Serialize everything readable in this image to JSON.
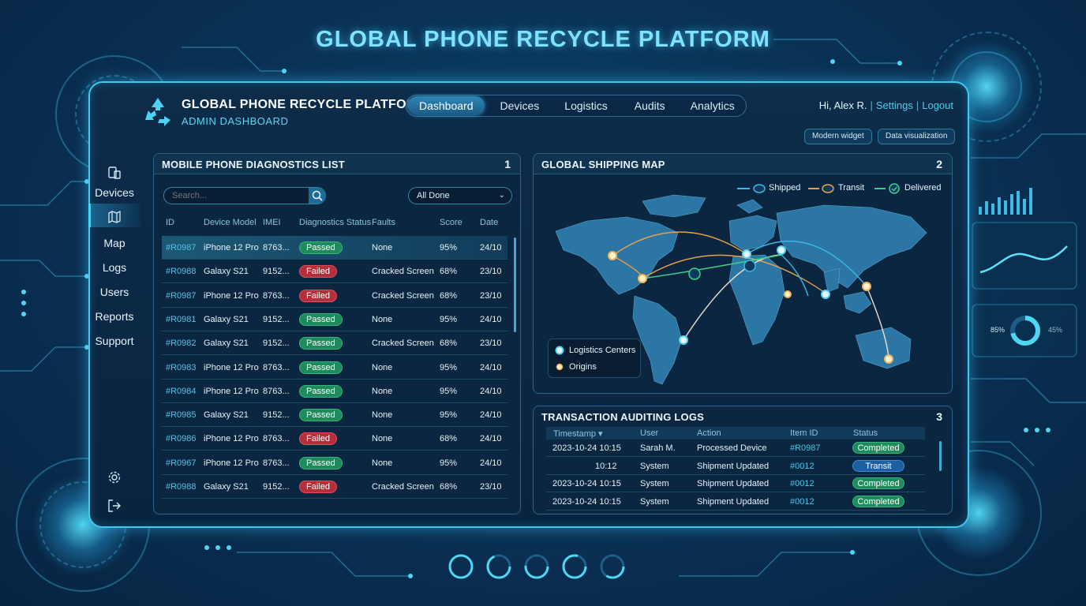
{
  "hero_title": "GLOBAL PHONE RECYCLE PLATFORM",
  "header": {
    "brand": "GLOBAL PHONE RECYCLE PLATFORM",
    "subtitle": "ADMIN DASHBOARD",
    "nav": [
      "Dashboard",
      "Devices",
      "Logistics",
      "Audits",
      "Analytics"
    ],
    "active_nav": "Dashboard",
    "greeting": "Hi, Alex R.",
    "settings": "Settings",
    "logout": "Logout",
    "widget_buttons": [
      "Modern widget",
      "Data visualization"
    ]
  },
  "sidebar": {
    "items": [
      "Devices",
      "Map",
      "Logs",
      "Users",
      "Reports",
      "Support"
    ],
    "active": "Map"
  },
  "diagnostics": {
    "title": "MOBILE PHONE DIAGNOSTICS LIST",
    "number": "1",
    "search_placeholder": "Search...",
    "filter": "All Done",
    "columns": [
      "ID",
      "Device Model",
      "IMEI",
      "Diagnostics Status",
      "Faults",
      "Score",
      "Date"
    ],
    "rows": [
      {
        "id": "#R0987",
        "model": "iPhone 12 Pro",
        "imei": "8763...",
        "status": "Passed",
        "faults": "None",
        "score": "95%",
        "date": "24/10"
      },
      {
        "id": "#R0988",
        "model": "Galaxy S21",
        "imei": "9152...",
        "status": "Failed",
        "faults": "Cracked Screen",
        "score": "68%",
        "date": "23/10"
      },
      {
        "id": "#R0987",
        "model": "iPhone 12 Pro",
        "imei": "8763...",
        "status": "Failed",
        "faults": "Cracked Screen",
        "score": "68%",
        "date": "23/10"
      },
      {
        "id": "#R0981",
        "model": "Galaxy S21",
        "imei": "9152...",
        "status": "Passed",
        "faults": "None",
        "score": "95%",
        "date": "24/10"
      },
      {
        "id": "#R0982",
        "model": "Galaxy S21",
        "imei": "9152...",
        "status": "Passed",
        "faults": "Cracked Screen",
        "score": "68%",
        "date": "23/10"
      },
      {
        "id": "#R0983",
        "model": "iPhone 12 Pro",
        "imei": "8763...",
        "status": "Passed",
        "faults": "None",
        "score": "95%",
        "date": "24/10"
      },
      {
        "id": "#R0984",
        "model": "iPhone 12 Pro",
        "imei": "8763...",
        "status": "Passed",
        "faults": "None",
        "score": "95%",
        "date": "24/10"
      },
      {
        "id": "#R0985",
        "model": "Galaxy S21",
        "imei": "9152...",
        "status": "Passed",
        "faults": "None",
        "score": "95%",
        "date": "24/10"
      },
      {
        "id": "#R0986",
        "model": "iPhone 12 Pro",
        "imei": "8763...",
        "status": "Failed",
        "faults": "None",
        "score": "68%",
        "date": "24/10"
      },
      {
        "id": "#R0967",
        "model": "iPhone 12 Pro",
        "imei": "8763...",
        "status": "Passed",
        "faults": "None",
        "score": "95%",
        "date": "24/10"
      },
      {
        "id": "#R0988",
        "model": "Galaxy S21",
        "imei": "9152...",
        "status": "Failed",
        "faults": "Cracked Screen",
        "score": "68%",
        "date": "23/10"
      }
    ]
  },
  "map": {
    "title": "GLOBAL SHIPPING MAP",
    "number": "2",
    "legend": [
      "Shipped",
      "Transit",
      "Delivered"
    ],
    "legend_colors": [
      "#3ab8e8",
      "#e8a14a",
      "#3fcf8e"
    ],
    "markers_legend": [
      "Logistics Centers",
      "Origins"
    ]
  },
  "logs": {
    "title": "TRANSACTION AUDITING LOGS",
    "number": "3",
    "columns": [
      "Timestamp ▾",
      "User",
      "Action",
      "Item ID",
      "Status"
    ],
    "rows": [
      {
        "time": "2023-10-24 10:15",
        "user": "Sarah M.",
        "action": "Processed Device",
        "item": "#R0987",
        "status": "Completed"
      },
      {
        "time": "10:12",
        "user": "System",
        "action": "Shipment Updated",
        "item": "#0012",
        "status": "Transit"
      },
      {
        "time": "2023-10-24 10:15",
        "user": "System",
        "action": "Shipment Updated",
        "item": "#0012",
        "status": "Completed"
      },
      {
        "time": "2023-10-24 10:15",
        "user": "System",
        "action": "Shipment Updated",
        "item": "#0012",
        "status": "Completed"
      }
    ]
  },
  "side_widgets": {
    "gauge_left": "85%",
    "gauge_right": "45%"
  }
}
